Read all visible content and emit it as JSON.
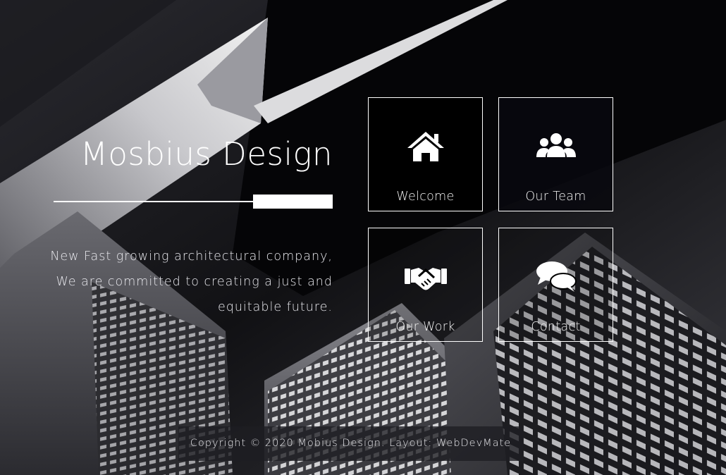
{
  "site": {
    "title": "Mosbius Design",
    "tagline": "New Fast growing architectural company, We are committed to creating a just and equitable future."
  },
  "nav": {
    "tiles": [
      {
        "label": "Welcome",
        "icon": "home-icon"
      },
      {
        "label": "Our Team",
        "icon": "users-icon"
      },
      {
        "label": "Our Work",
        "icon": "handshake-icon"
      },
      {
        "label": "Contact",
        "icon": "comments-icon"
      }
    ]
  },
  "footer": {
    "copyright": "Copyright © 2020 Mobius Design. Layout: ",
    "credit": "WebDevMate"
  },
  "colors": {
    "accent": "#ffffff",
    "background": "#0b0b0f",
    "tile_dark": "#000000"
  }
}
